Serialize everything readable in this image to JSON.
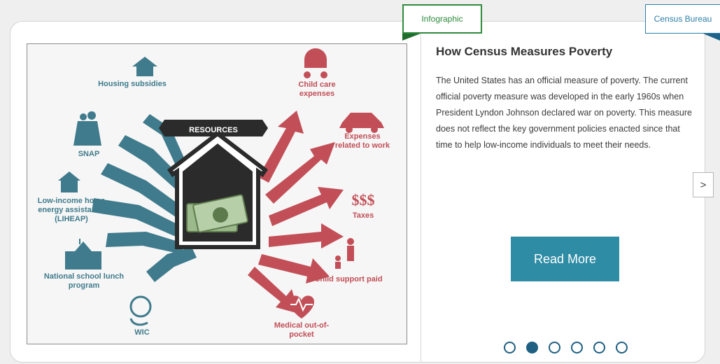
{
  "tags": {
    "category": "Infographic",
    "source": "Census Bureau"
  },
  "article": {
    "title": "How Census Measures Poverty",
    "body": "The United States has an official measure of poverty. The current official poverty measure was developed in the early 1960s when President Lyndon Johnson declared war on poverty. This measure does not reflect the key government policies enacted since that time to help low-income individuals to meet their needs.",
    "read_more_label": "Read More"
  },
  "navigation": {
    "next_label": ">",
    "dot_count": 6,
    "active_dot": 2
  },
  "infographic": {
    "center_label": "RESOURCES",
    "resources": [
      "Housing subsidies",
      "SNAP",
      "Low-income home energy assistance (LIHEAP)",
      "National school lunch program",
      "WIC"
    ],
    "expenses": [
      "Child care expenses",
      "Expenses related to work",
      "Taxes",
      "Child support paid",
      "Medical out-of-pocket"
    ],
    "taxes_symbol": "$$$",
    "colors": {
      "resources": "#3f7b8c",
      "expenses": "#c24f57",
      "house": "#2b2b2b",
      "money": "#9bb98a"
    }
  },
  "colors": {
    "accent": "#2f8ca5",
    "infographic_tag": "#2e8b3c",
    "census_tag": "#2d7fa6",
    "dot": "#1f5f82"
  }
}
